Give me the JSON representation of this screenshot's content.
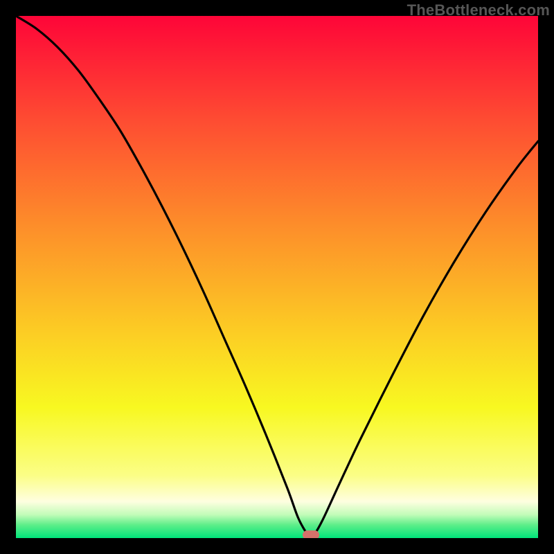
{
  "watermark": "TheBottleneck.com",
  "colors": {
    "frame": "#000000",
    "marker": "#d5716b",
    "curve": "#000000",
    "gradient_stops": [
      {
        "pos": 0.0,
        "color": "#fe0538"
      },
      {
        "pos": 0.2,
        "color": "#fe4c32"
      },
      {
        "pos": 0.4,
        "color": "#fd8d2a"
      },
      {
        "pos": 0.6,
        "color": "#fccb24"
      },
      {
        "pos": 0.75,
        "color": "#f8f821"
      },
      {
        "pos": 0.88,
        "color": "#fbfe86"
      },
      {
        "pos": 0.93,
        "color": "#fefee0"
      },
      {
        "pos": 0.955,
        "color": "#c3fcb9"
      },
      {
        "pos": 0.975,
        "color": "#5dee89"
      },
      {
        "pos": 1.0,
        "color": "#00e47a"
      }
    ]
  },
  "plot": {
    "inner_left": 23,
    "inner_top": 23,
    "inner_width": 754,
    "inner_height": 754
  },
  "chart_data": {
    "type": "line",
    "title": "",
    "xlabel": "",
    "ylabel": "",
    "xlim": [
      0,
      100
    ],
    "ylim": [
      0,
      100
    ],
    "x": [
      0,
      4,
      8,
      12,
      16,
      20,
      24,
      28,
      32,
      36,
      40,
      44,
      48,
      52,
      54,
      55.5,
      56.5,
      57.5,
      59,
      62,
      66,
      72,
      78,
      84,
      90,
      96,
      100
    ],
    "values": [
      100,
      97.5,
      94,
      89.5,
      84,
      78,
      71,
      63.5,
      55.5,
      47,
      38,
      29,
      19.5,
      9.5,
      4,
      1.2,
      0,
      1.2,
      4,
      10.5,
      19,
      31,
      42.5,
      53,
      62.5,
      71,
      76
    ],
    "optimal_x": 56.5,
    "optimal_width": 3.2,
    "marker_y": 0
  }
}
